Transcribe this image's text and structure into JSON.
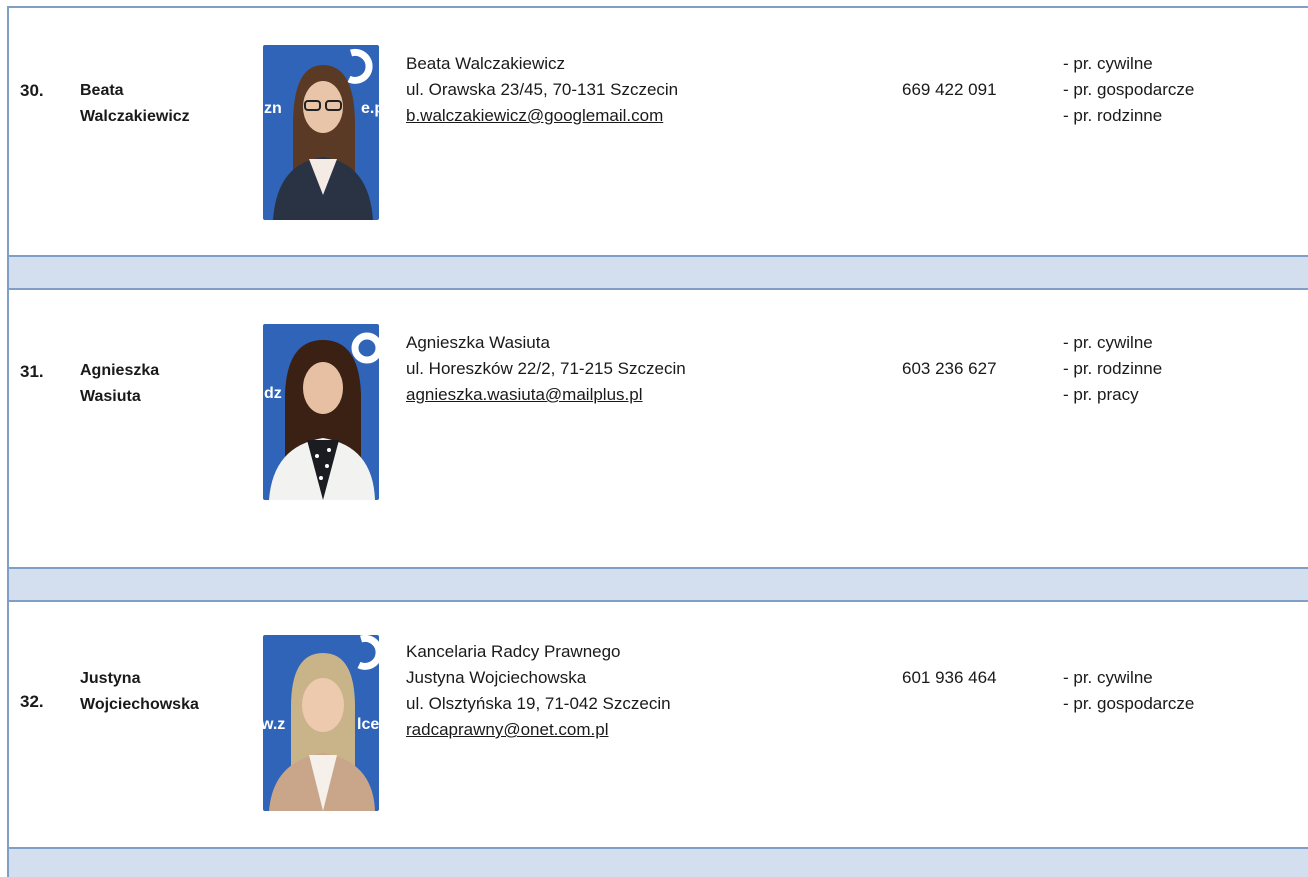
{
  "entries": [
    {
      "number": "30.",
      "name_first": "Beata",
      "name_last": "Walczakiewicz",
      "info": [
        "Beata Walczakiewicz",
        "ul. Orawska 23/45, 70-131 Szczecin"
      ],
      "email": "b.walczakiewicz@googlemail.com",
      "phone": "669 422 091",
      "specs": [
        "- pr. cywilne",
        "- pr. gospodarcze",
        "- pr. rodzinne"
      ],
      "photo_bg": "#2f64b8",
      "photo_logo_text": "zn        e.p",
      "hair": "#5a3a24",
      "jacket": "#2a3344"
    },
    {
      "number": "31.",
      "name_first": "Agnieszka",
      "name_last": "Wasiuta",
      "info": [
        "Agnieszka Wasiuta",
        "ul. Horeszków 22/2, 71-215 Szczecin"
      ],
      "email": "agnieszka.wasiuta@mailplus.pl",
      "phone": "603 236 627",
      "specs": [
        "- pr. cywilne",
        "- pr. rodzinne",
        "- pr. pracy"
      ],
      "photo_bg": "#2f64b8",
      "photo_logo_text": "dz",
      "hair": "#3b2014",
      "jacket": "#f2f2f0"
    },
    {
      "number": "32.",
      "name_first": "Justyna",
      "name_last": "Wojciechowska",
      "info": [
        "Kancelaria Radcy Prawnego",
        "Justyna Wojciechowska",
        "ul. Olsztyńska 19, 71-042 Szczecin"
      ],
      "email": "radcaprawny@onet.com.pl",
      "phone": "601 936 464",
      "specs": [
        "- pr. cywilne",
        "- pr. gospodarcze"
      ],
      "photo_bg": "#2f64b8",
      "photo_logo_text": "w.z         lce",
      "hair": "#c9b48a",
      "jacket": "#c9a58a"
    }
  ]
}
